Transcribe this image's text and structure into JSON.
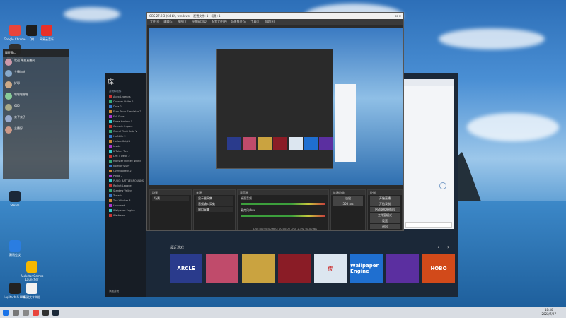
{
  "desktop": {
    "icons": [
      {
        "label": "Google Chrome",
        "color": "#e8453c"
      },
      {
        "label": "QQ",
        "color": "#1e1e1e"
      },
      {
        "label": "网易云音乐",
        "color": "#e8302a"
      },
      {
        "label": "OBS Studio",
        "color": "#303030"
      },
      {
        "label": "Steam",
        "color": "#1b2838"
      },
      {
        "label": "腾讯会议",
        "color": "#2a7de1"
      },
      {
        "label": "Rockstar Games Launcher",
        "color": "#f6b800"
      },
      {
        "label": "Logitech G HUB",
        "color": "#222222"
      },
      {
        "label": "新建文本文档",
        "color": "#f2f2f2"
      }
    ]
  },
  "chat": {
    "title": "聊天窗口",
    "messages": [
      {
        "text": "欢迎 来到直播间"
      },
      {
        "text": "主播加油"
      },
      {
        "text": "好耶"
      },
      {
        "text": "哈哈哈哈哈"
      },
      {
        "text": "666"
      },
      {
        "text": "来了来了"
      },
      {
        "text": "主播好"
      }
    ]
  },
  "obs": {
    "title": "OBS 27.2.3 (64-bit, windows) - 配置文件: 1 - 场景: 1",
    "menu": [
      "文件(F)",
      "编辑(E)",
      "视图(V)",
      "停靠窗口(D)",
      "配置文件(P)",
      "场景集合(S)",
      "工具(T)",
      "帮助(H)"
    ],
    "panels": {
      "scenes": "场景",
      "sources": "来源",
      "mixer": "混音器",
      "transitions": "转场特效",
      "controls": "控制"
    },
    "scene_items": [
      "场景"
    ],
    "source_items": [
      "显示器采集",
      "音频输入采集",
      "窗口采集"
    ],
    "mixer_tracks": [
      "桌面音频",
      "麦克风/Aux"
    ],
    "transition": {
      "name": "淡出",
      "duration": "300 ms"
    },
    "controls": [
      "开始直播",
      "开始录制",
      "启动虚拟摄像机",
      "工作室模式",
      "设置",
      "退出"
    ],
    "status": "LIVE: 00:00:00  REC: 00:00:00  CPU: 2.3%, 60.00 fps"
  },
  "steam": {
    "title": "库",
    "filter": "游戏和软件",
    "games": [
      "Apex Legends",
      "Counter-Strike 2",
      "Dota 2",
      "Euro Truck Simulator 2",
      "Fall Guys",
      "Forza Horizon 5",
      "Genshin Impact",
      "Grand Theft Auto V",
      "Half-Life 2",
      "Hollow Knight",
      "Inside",
      "It Takes Two",
      "Left 4 Dead 2",
      "Monster Hunter: World",
      "No Man's Sky",
      "Overcooked! 2",
      "Portal 2",
      "PUBG: BATTLEGROUNDS",
      "Rocket League",
      "Stardew Valley",
      "Terraria",
      "The Witcher 3",
      "Unturned",
      "Wallpaper Engine",
      "Warframe"
    ],
    "recent_label": "最近游戏",
    "recent": [
      {
        "name": "ARCLE",
        "color": "#2a3b8c"
      },
      {
        "name": "",
        "color": "#c04b6b"
      },
      {
        "name": "",
        "color": "#caa340"
      },
      {
        "name": "",
        "color": "#8a1c26"
      },
      {
        "name": "传",
        "color": "#dce6f0"
      },
      {
        "name": "Wallpaper Engine",
        "color": "#1f6fd0"
      },
      {
        "name": "",
        "color": "#5b2fa0"
      },
      {
        "name": "HOBO",
        "color": "#d24a1a"
      }
    ],
    "add_game": "添加游戏"
  },
  "taskbar": {
    "time": "18:40",
    "date": "2022/7/27"
  }
}
